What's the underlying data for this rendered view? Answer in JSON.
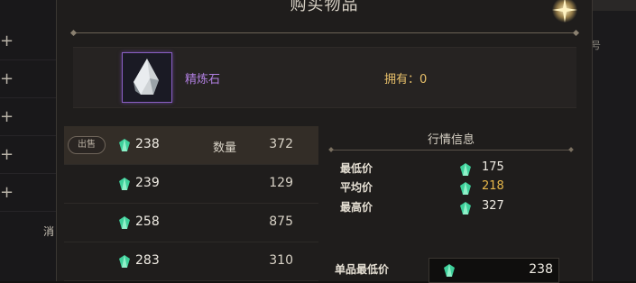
{
  "title": "购买物品",
  "item": {
    "name": "精炼石",
    "owned_label": "拥有：0"
  },
  "sell_badge": "出售",
  "quantity_label": "数量",
  "listings": [
    {
      "price": "238",
      "qty": "372"
    },
    {
      "price": "239",
      "qty": "129"
    },
    {
      "price": "258",
      "qty": "875"
    },
    {
      "price": "283",
      "qty": "310"
    }
  ],
  "market": {
    "title": "行情信息",
    "low_label": "最低价",
    "low_value": "175",
    "avg_label": "平均价",
    "avg_value": "218",
    "high_label": "最高价",
    "high_value": "327"
  },
  "unit_min": {
    "label": "单品最低价",
    "value": "238"
  },
  "background": {
    "left_char": "消",
    "right_char": "号"
  },
  "colors": {
    "gem": "#3ecf9a",
    "item_name": "#b07fe0",
    "owned": "#e8c06a",
    "avg": "#e8b84a"
  },
  "icons": [
    "plus-icon",
    "gem-currency-icon",
    "close-star-icon",
    "refine-stone-icon"
  ]
}
